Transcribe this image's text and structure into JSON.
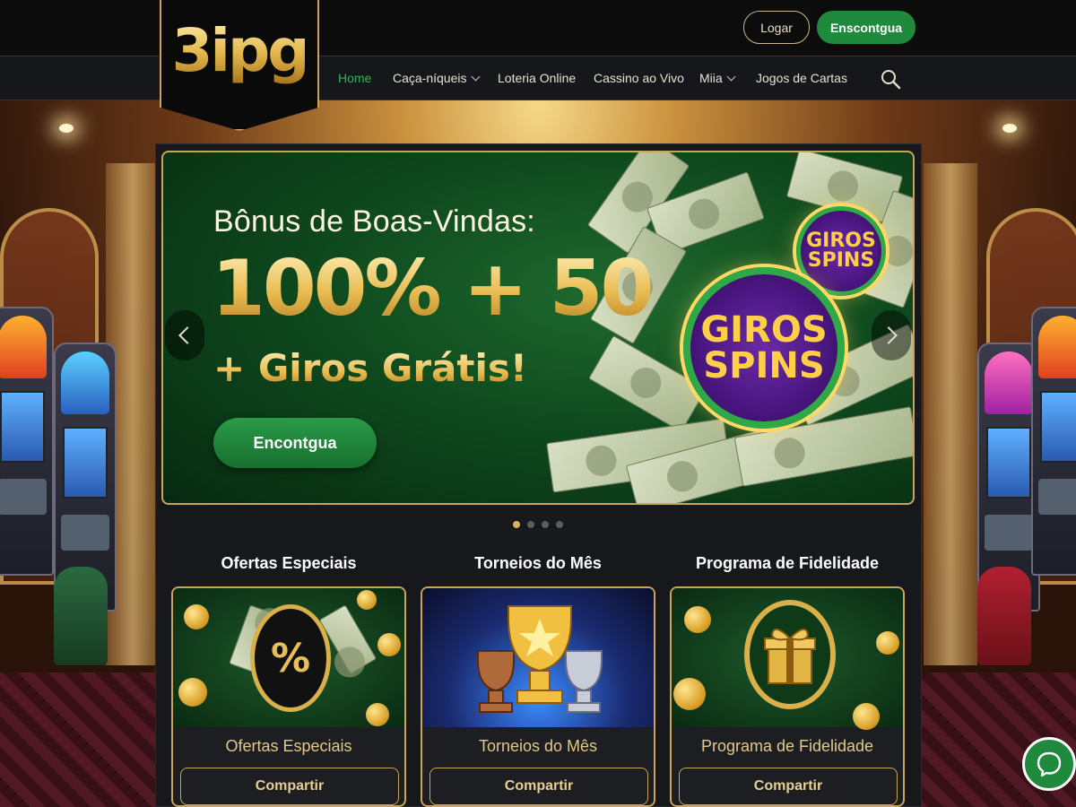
{
  "brand": {
    "logo_text": "3ipg"
  },
  "header": {
    "login_label": "Logar",
    "register_label": "Enscontgua"
  },
  "nav": {
    "items": [
      {
        "label": "Home",
        "active": true,
        "dropdown": false
      },
      {
        "label": "Caça-níqueis",
        "active": false,
        "dropdown": true
      },
      {
        "label": "Loteria Online",
        "active": false,
        "dropdown": false
      },
      {
        "label": "Cassino ao Vivo",
        "active": false,
        "dropdown": false
      },
      {
        "label": "Miia",
        "active": false,
        "dropdown": true
      },
      {
        "label": "Jogos de Cartas",
        "active": false,
        "dropdown": false
      }
    ],
    "search_icon": "search-icon"
  },
  "hero": {
    "subtitle": "Bônus de Boas-Vindas:",
    "headline": "100% + 50",
    "tagline": "+ Giros Grátis!",
    "cta_label": "Encontgua",
    "badge_large": {
      "line1": "GIROS",
      "line2": "SPINS"
    },
    "badge_small": {
      "line1": "GIROS",
      "line2": "SPINS"
    },
    "slide_count": 4,
    "active_slide": 1
  },
  "sections": [
    {
      "title": "Ofertas Especiais",
      "caption": "Ofertas Especiais",
      "button": "Compartir",
      "icon": "percent-icon",
      "symbol": "%"
    },
    {
      "title": "Torneios do Mês",
      "caption": "Torneios do Mês",
      "button": "Compartir",
      "icon": "trophy-icon"
    },
    {
      "title": "Programa de Fidelidade",
      "caption": "Programa de Fidelidade",
      "button": "Compartir",
      "icon": "gift-icon"
    }
  ],
  "colors": {
    "accent_green": "#1f8a3e",
    "nav_active": "#2fb55a",
    "gold": "#c9a45a",
    "dark_bg": "#16181b"
  }
}
